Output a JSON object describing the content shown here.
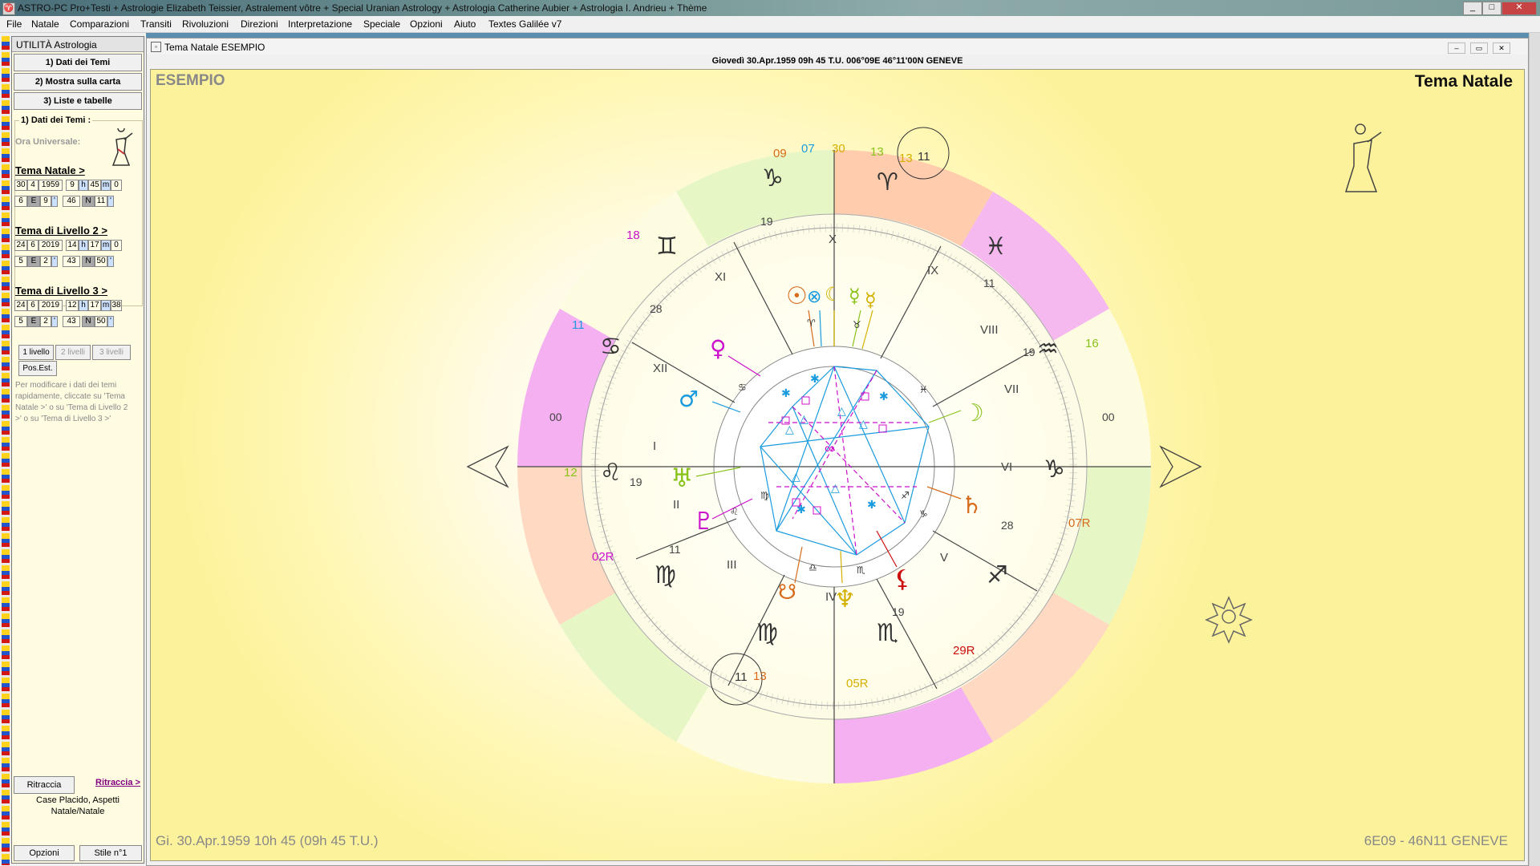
{
  "window": {
    "title": "ASTRO-PC Pro+Testi + Astrologie Elizabeth Teissier, Astralement vôtre + Special Uranian Astrology + Astrologia Catherine Aubier + Astrologia I. Andrieu + Thème",
    "app_icon": "astro-icon"
  },
  "menu": [
    "File",
    "Natale",
    "Comparazioni",
    "Transiti",
    "Rivoluzioni",
    "Direzioni",
    "Interpretazione",
    "Speciale",
    "Opzioni",
    "Aiuto",
    "Textes Galilée v7"
  ],
  "left_panel": {
    "header": "UTILITÀ Astrologia",
    "buttons": [
      "1) Dati dei Temi",
      "2) Mostra sulla carta",
      "3) Liste e tabelle"
    ],
    "group_title": "1) Dati dei Temi :",
    "ora_label": "Ora Universale:",
    "themes": [
      {
        "label": "Tema Natale >",
        "day": "30",
        "month": "4",
        "year": "1959",
        "hour": "9",
        "h": "h",
        "min": "45",
        "m": "m",
        "sec": "0",
        "lon_deg": "6",
        "ew": "E",
        "lon_min": "9",
        "lat_deg": "46",
        "ns": "N",
        "lat_min": "11"
      },
      {
        "label": "Tema di Livello 2 >",
        "day": "24",
        "month": "6",
        "year": "2019",
        "hour": "14",
        "h": "h",
        "min": "17",
        "m": "m",
        "sec": "0",
        "lon_deg": "5",
        "ew": "E",
        "lon_min": "2",
        "lat_deg": "43",
        "ns": "N",
        "lat_min": "50"
      },
      {
        "label": "Tema di Livello 3 >",
        "day": "24",
        "month": "6",
        "year": "2019",
        "hour": "12",
        "h": "h",
        "min": "17",
        "m": "m",
        "sec": "38",
        "lon_deg": "5",
        "ew": "E",
        "lon_min": "2",
        "lat_deg": "43",
        "ns": "N",
        "lat_min": "50"
      }
    ],
    "levels": [
      "1 livello",
      "2 livelli",
      "3 livelli"
    ],
    "pos_est": "Pos.Est.",
    "info": "Per modificare i dati dei temi rapidamente, cliccate su 'Tema Natale >' o su 'Tema di Livello 2 >' o su 'Tema di Livello 3 >'",
    "ritraccia": "Ritraccia",
    "ritraccia_link": "Ritraccia >",
    "case_line1": "Case Placido, Aspetti",
    "case_line2": "Natale/Natale",
    "opzioni": "Opzioni",
    "stile": "Stile n°1"
  },
  "chart_window": {
    "title": "Tema Natale  ESEMPIO",
    "date_line": "Giovedì 30.Apr.1959 09h 45 T.U. 006°09E 46°11'00N  GENEVE",
    "name": "ESEMPIO",
    "chart_type": "Tema Natale",
    "footer_left": "Gi. 30.Apr.1959 10h 45 (09h 45 T.U.)",
    "footer_right": "6E09 - 46N11  GENEVE",
    "houses": [
      "I",
      "II",
      "III",
      "IV",
      "V",
      "VI",
      "VII",
      "VIII",
      "IX",
      "X",
      "XI",
      "XII"
    ],
    "ring_degrees": {
      "d28a": "28",
      "d19a": "19",
      "d11a": "11",
      "d19b": "19",
      "d28b": "28",
      "d11b": "11",
      "d19c": "19",
      "d19d": "19",
      "d00l": "00",
      "d00r": "00"
    },
    "outer_labels": {
      "o09": "09",
      "o07": "07",
      "o30": "30",
      "o13": "13",
      "o13b": "13",
      "o11c": "11",
      "o18": "18",
      "o11": "11",
      "o16": "16",
      "o12": "12",
      "o07R": "07R",
      "o02R": "02R",
      "o29R": "29R",
      "o05R": "05R",
      "o11b": "11",
      "o13c": "13"
    },
    "colors": {
      "fire": "#ffc7a6",
      "earth": "#e6f7c5",
      "air": "#fdfbe0",
      "water": "#f4b0f0",
      "blue": "#1a9bde",
      "magenta": "#cc11cc",
      "orange": "#d86a1c",
      "green": "#88c21a",
      "red": "#cc0d0d",
      "yellow": "#d4b000"
    }
  }
}
